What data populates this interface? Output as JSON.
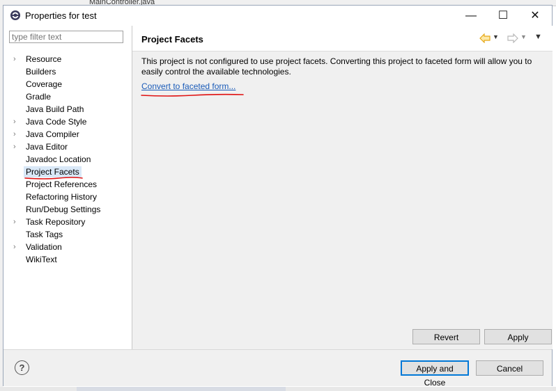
{
  "background": {
    "editor_tab": "MainController.java"
  },
  "window": {
    "title": "Properties for test",
    "controls": {
      "minimize": "—",
      "maximize": "☐",
      "close": "✕"
    }
  },
  "filter": {
    "placeholder": "type filter text"
  },
  "tree": [
    {
      "label": "Resource",
      "expandable": true
    },
    {
      "label": "Builders",
      "expandable": false
    },
    {
      "label": "Coverage",
      "expandable": false
    },
    {
      "label": "Gradle",
      "expandable": false
    },
    {
      "label": "Java Build Path",
      "expandable": false
    },
    {
      "label": "Java Code Style",
      "expandable": true
    },
    {
      "label": "Java Compiler",
      "expandable": true
    },
    {
      "label": "Java Editor",
      "expandable": true
    },
    {
      "label": "Javadoc Location",
      "expandable": false
    },
    {
      "label": "Project Facets",
      "expandable": false,
      "selected": true
    },
    {
      "label": "Project References",
      "expandable": false
    },
    {
      "label": "Refactoring History",
      "expandable": false
    },
    {
      "label": "Run/Debug Settings",
      "expandable": false
    },
    {
      "label": "Task Repository",
      "expandable": true
    },
    {
      "label": "Task Tags",
      "expandable": false
    },
    {
      "label": "Validation",
      "expandable": true
    },
    {
      "label": "WikiText",
      "expandable": false
    }
  ],
  "page": {
    "title": "Project Facets",
    "description": "This project is not configured to use project facets. Converting this project to faceted form will allow you to easily control the available technologies.",
    "link": "Convert to faceted form...",
    "nav_icons": [
      "back-arrow-icon",
      "forward-arrow-icon",
      "view-menu-icon"
    ]
  },
  "buttons": {
    "revert": "Revert",
    "apply": "Apply",
    "apply_close": "Apply and Close",
    "cancel": "Cancel",
    "help": "?"
  },
  "colors": {
    "link": "#1a5bb8",
    "selection": "#d9e8f7",
    "annotation": "#e01010",
    "nav_arrow": "#e6a817"
  }
}
